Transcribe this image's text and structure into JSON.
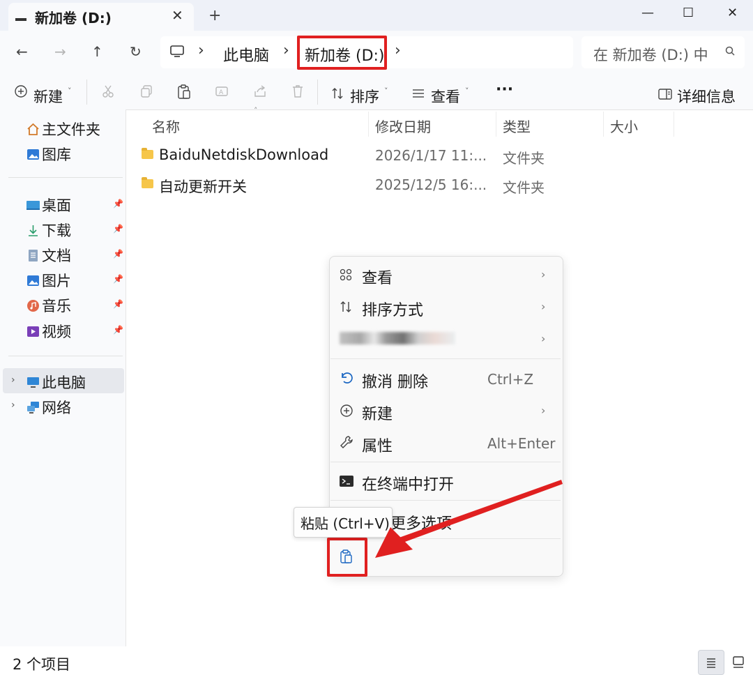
{
  "window": {
    "tab_title": "新加卷 (D:)",
    "tab_close": "✕",
    "tab_add": "+",
    "minimize": "—",
    "maximize": "☐",
    "close": "✕"
  },
  "nav": {
    "back": "←",
    "forward": "→",
    "up": "↑",
    "refresh": "↻"
  },
  "breadcrumb": {
    "items": [
      "此电脑",
      "新加卷 (D:)"
    ],
    "separator": "›"
  },
  "search": {
    "placeholder": "在 新加卷 (D:) 中"
  },
  "toolbar": {
    "new_label": "新建",
    "sort_label": "排序",
    "view_label": "查看",
    "more_label": "···",
    "details_label": "详细信息"
  },
  "sidebar": {
    "quick": [
      {
        "label": "主文件夹",
        "icon": "home-icon"
      },
      {
        "label": "图库",
        "icon": "gallery-icon"
      }
    ],
    "pinned": [
      {
        "label": "桌面",
        "icon": "desktop-icon"
      },
      {
        "label": "下载",
        "icon": "download-icon"
      },
      {
        "label": "文档",
        "icon": "document-icon"
      },
      {
        "label": "图片",
        "icon": "picture-icon"
      },
      {
        "label": "音乐",
        "icon": "music-icon"
      },
      {
        "label": "视频",
        "icon": "video-icon"
      }
    ],
    "locations": [
      {
        "label": "此电脑",
        "icon": "computer-icon",
        "selected": true
      },
      {
        "label": "网络",
        "icon": "network-icon",
        "selected": false
      }
    ]
  },
  "table": {
    "columns": [
      "名称",
      "修改日期",
      "类型",
      "大小"
    ],
    "rows": [
      {
        "name": "BaiduNetdiskDownload",
        "date": "2026/1/17 11:...",
        "type": "文件夹",
        "size": ""
      },
      {
        "name": "自动更新开关",
        "date": "2025/12/5 16:...",
        "type": "文件夹",
        "size": ""
      }
    ]
  },
  "context_menu": {
    "items": [
      {
        "label": "查看",
        "shortcut": "",
        "submenu": true,
        "icon": "grid-icon"
      },
      {
        "label": "排序方式",
        "shortcut": "",
        "submenu": true,
        "icon": "sort-icon"
      },
      {
        "label": "",
        "shortcut": "",
        "submenu": true,
        "icon": "group-icon"
      },
      {
        "label": "撤消 删除",
        "shortcut": "Ctrl+Z",
        "submenu": false,
        "icon": "undo-icon"
      },
      {
        "label": "新建",
        "shortcut": "",
        "submenu": true,
        "icon": "plus-circle-icon"
      },
      {
        "label": "属性",
        "shortcut": "Alt+Enter",
        "submenu": false,
        "icon": "wrench-icon"
      },
      {
        "label": "在终端中打开",
        "shortcut": "",
        "submenu": false,
        "icon": "terminal-icon"
      },
      {
        "label": "更多选项",
        "shortcut": "",
        "submenu": false,
        "icon": "more-options-icon"
      }
    ],
    "tooltip": "粘贴 (Ctrl+V)"
  },
  "status": {
    "count": "2 个项目"
  },
  "colors": {
    "highlight": "#e02020",
    "accent": "#1a66c2",
    "folder": "#f6c64a"
  }
}
